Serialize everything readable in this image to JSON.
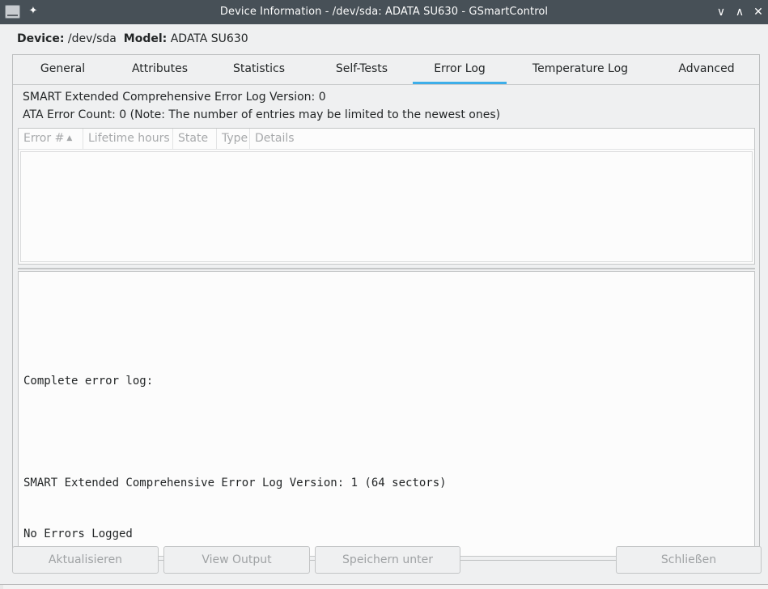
{
  "window": {
    "title": "Device Information - /dev/sda: ADATA SU630 - GSmartControl",
    "pin_glyph": "✦",
    "controls": {
      "minimize": "∨",
      "maximize": "∧",
      "close": "✕"
    }
  },
  "device": {
    "device_label": "Device:",
    "device_value": "/dev/sda",
    "model_label": "Model:",
    "model_value": "ADATA SU630"
  },
  "tabs": [
    {
      "label": "General"
    },
    {
      "label": "Attributes"
    },
    {
      "label": "Statistics"
    },
    {
      "label": "Self-Tests"
    },
    {
      "label": "Error Log"
    },
    {
      "label": "Temperature Log"
    },
    {
      "label": "Advanced"
    }
  ],
  "active_tab": "Error Log",
  "error_log": {
    "version_line": "SMART Extended Comprehensive Error Log Version: 0",
    "count_line": "ATA Error Count: 0 (Note: The number of entries may be limited to the newest ones)",
    "columns": [
      "Error #",
      "Lifetime hours",
      "State",
      "Type",
      "Details"
    ],
    "sort_glyph": "▲",
    "rows": [],
    "log_lines": [
      "",
      "Complete error log:",
      "",
      "SMART Extended Comprehensive Error Log Version: 1 (64 sectors)",
      "No Errors Logged"
    ]
  },
  "buttons": {
    "refresh": "Aktualisieren",
    "view_output": "View Output",
    "save_as": "Speichern unter",
    "close": "Schließen"
  },
  "colors": {
    "titlebar": "#475057",
    "accent": "#3daee9",
    "window_bg": "#eff0f1",
    "disabled_text": "#9fa2a4"
  }
}
